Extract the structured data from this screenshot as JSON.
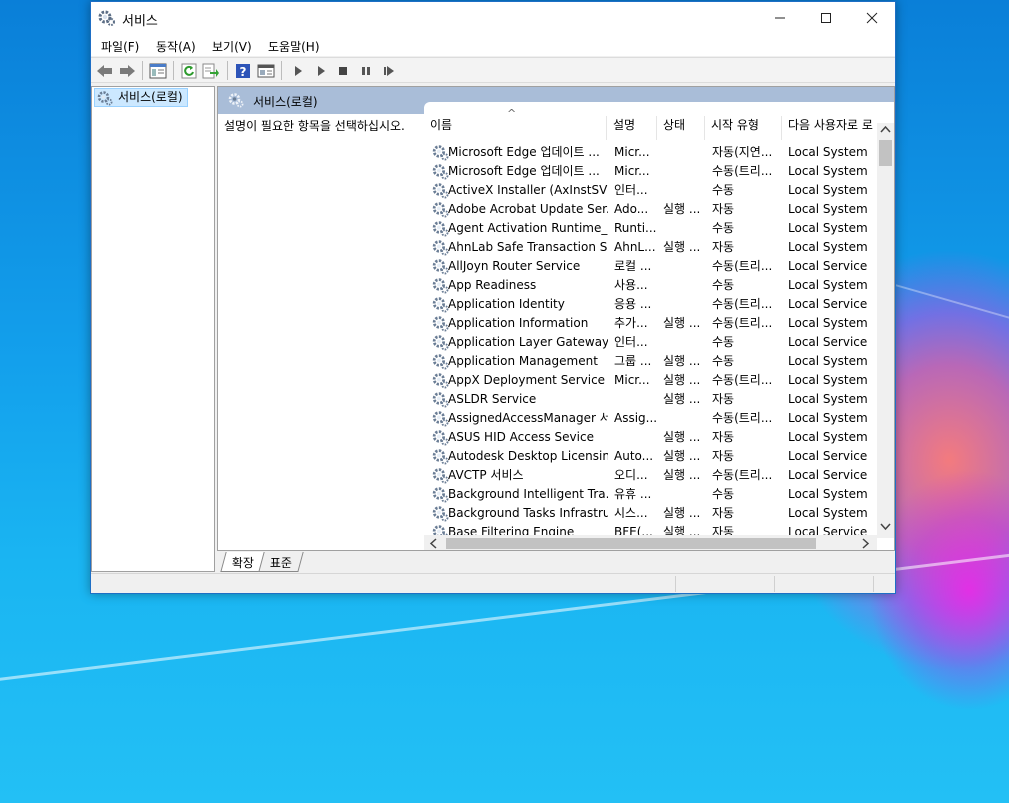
{
  "window": {
    "title": "서비스"
  },
  "menu": [
    "파일(F)",
    "동작(A)",
    "보기(V)",
    "도움말(H)"
  ],
  "toolbar": {
    "buttons": [
      "back-icon",
      "forward-icon",
      "show-hide-tree-icon",
      "refresh-icon",
      "export-list-icon",
      "help-icon",
      "properties-icon",
      "start-service-icon",
      "start-service-alt-icon",
      "stop-service-icon",
      "pause-service-icon",
      "restart-service-icon"
    ]
  },
  "tree": {
    "root_label": "서비스(로컬)"
  },
  "pane": {
    "header_title": "서비스(로컬)",
    "description_prompt": "설명이 필요한 항목을 선택하십시오."
  },
  "list": {
    "columns": [
      "이름",
      "설명",
      "상태",
      "시작 유형",
      "다음 사용자로 로"
    ],
    "rows": [
      [
        "Microsoft Edge 업데이트 ...",
        "Micr...",
        "",
        "자동(지연...",
        "Local System"
      ],
      [
        "Microsoft Edge 업데이트 ...",
        "Micr...",
        "",
        "수동(트리...",
        "Local System"
      ],
      [
        "ActiveX Installer (AxInstSV)",
        "인터...",
        "",
        "수동",
        "Local System"
      ],
      [
        "Adobe Acrobat Update Ser...",
        "Ado...",
        "실행 ...",
        "자동",
        "Local System"
      ],
      [
        "Agent Activation Runtime_...",
        "Runti...",
        "",
        "수동",
        "Local System"
      ],
      [
        "AhnLab Safe Transaction S...",
        "AhnL...",
        "실행 ...",
        "자동",
        "Local System"
      ],
      [
        "AllJoyn Router Service",
        "로컬 ...",
        "",
        "수동(트리...",
        "Local Service"
      ],
      [
        "App Readiness",
        "사용...",
        "",
        "수동",
        "Local System"
      ],
      [
        "Application Identity",
        "응용 ...",
        "",
        "수동(트리...",
        "Local Service"
      ],
      [
        "Application Information",
        "추가...",
        "실행 ...",
        "수동(트리...",
        "Local System"
      ],
      [
        "Application Layer Gateway ...",
        "인터...",
        "",
        "수동",
        "Local Service"
      ],
      [
        "Application Management",
        "그룹 ...",
        "실행 ...",
        "수동",
        "Local System"
      ],
      [
        "AppX Deployment Service ...",
        "Micr...",
        "실행 ...",
        "수동(트리...",
        "Local System"
      ],
      [
        "ASLDR Service",
        "",
        "실행 ...",
        "자동",
        "Local System"
      ],
      [
        "AssignedAccessManager 서...",
        "Assig...",
        "",
        "수동(트리...",
        "Local System"
      ],
      [
        "ASUS HID Access Sevice",
        "",
        "실행 ...",
        "자동",
        "Local System"
      ],
      [
        "Autodesk Desktop Licensin...",
        "Auto...",
        "실행 ...",
        "자동",
        "Local Service"
      ],
      [
        "AVCTP 서비스",
        "오디...",
        "실행 ...",
        "수동(트리...",
        "Local Service"
      ],
      [
        "Background Intelligent Tra...",
        "유휴 ...",
        "",
        "수동",
        "Local System"
      ],
      [
        "Background Tasks Infrastru...",
        "시스...",
        "실행 ...",
        "자동",
        "Local System"
      ],
      [
        "Base Filtering Engine",
        "BFE(...",
        "실행 ...",
        "자동",
        "Local Service"
      ]
    ]
  },
  "tabs": [
    "확장",
    "표준"
  ],
  "colors": {
    "accent": "#0078d7",
    "header_band": "#a9bdd8",
    "selection": "#cce8ff"
  }
}
